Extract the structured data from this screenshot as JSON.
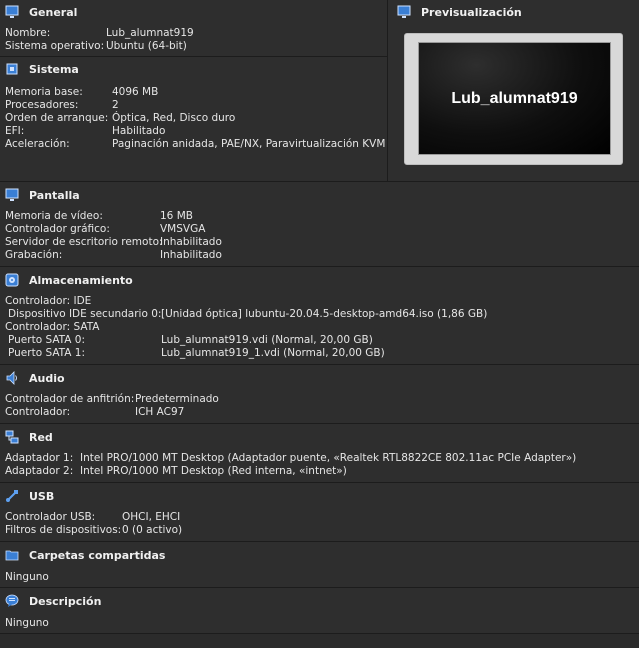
{
  "general": {
    "title": "General",
    "rows": [
      {
        "label": "Nombre:",
        "value": "Lub_alumnat919"
      },
      {
        "label": "Sistema operativo:",
        "value": "Ubuntu (64-bit)"
      }
    ]
  },
  "preview": {
    "title": "Previsualización",
    "screen_text": "Lub_alumnat919"
  },
  "sistema": {
    "title": "Sistema",
    "rows": [
      {
        "label": "Memoria base:",
        "value": "4096 MB"
      },
      {
        "label": "Procesadores:",
        "value": "2"
      },
      {
        "label": "Orden de arranque:",
        "value": "Óptica, Red, Disco duro"
      },
      {
        "label": "EFI:",
        "value": "Habilitado"
      },
      {
        "label": "Aceleración:",
        "value": "Paginación anidada, PAE/NX, Paravirtualización KVM"
      }
    ]
  },
  "pantalla": {
    "title": "Pantalla",
    "rows": [
      {
        "label": "Memoria de vídeo:",
        "value": "16 MB"
      },
      {
        "label": "Controlador gráfico:",
        "value": "VMSVGA"
      },
      {
        "label": "Servidor de escritorio remoto:",
        "value": "Inhabilitado"
      },
      {
        "label": "Grabación:",
        "value": "Inhabilitado"
      }
    ]
  },
  "almacenamiento": {
    "title": "Almacenamiento",
    "rows": [
      {
        "label": "Controlador: IDE",
        "value": ""
      },
      {
        "label": " Dispositivo IDE secundario 0:",
        "value": "[Unidad óptica] lubuntu-20.04.5-desktop-amd64.iso (1,86 GB)"
      },
      {
        "label": "Controlador: SATA",
        "value": ""
      },
      {
        "label": " Puerto SATA 0:",
        "value": "Lub_alumnat919.vdi (Normal, 20,00 GB)"
      },
      {
        "label": " Puerto SATA 1:",
        "value": "Lub_alumnat919_1.vdi (Normal, 20,00 GB)"
      }
    ]
  },
  "audio": {
    "title": "Audio",
    "rows": [
      {
        "label": "Controlador de anfitrión:",
        "value": "Predeterminado"
      },
      {
        "label": "Controlador:",
        "value": "ICH AC97"
      }
    ]
  },
  "red": {
    "title": "Red",
    "rows": [
      {
        "label": "Adaptador 1:",
        "value": "Intel PRO/1000 MT Desktop (Adaptador puente, «Realtek RTL8822CE 802.11ac PCIe Adapter»)"
      },
      {
        "label": "Adaptador 2:",
        "value": "Intel PRO/1000 MT Desktop (Red interna, «intnet»)"
      }
    ]
  },
  "usb": {
    "title": "USB",
    "rows": [
      {
        "label": "Controlador USB:",
        "value": "OHCI, EHCI"
      },
      {
        "label": "Filtros de dispositivos:",
        "value": "0 (0 activo)"
      }
    ]
  },
  "carpetas": {
    "title": "Carpetas compartidas",
    "value": "Ninguno"
  },
  "descripcion": {
    "title": "Descripción",
    "value": "Ninguno"
  },
  "icons": [
    "monitor-icon",
    "chip-icon",
    "display-icon",
    "disk-icon",
    "speaker-icon",
    "network-icon",
    "usb-icon",
    "folder-icon",
    "speech-bubble-icon"
  ]
}
